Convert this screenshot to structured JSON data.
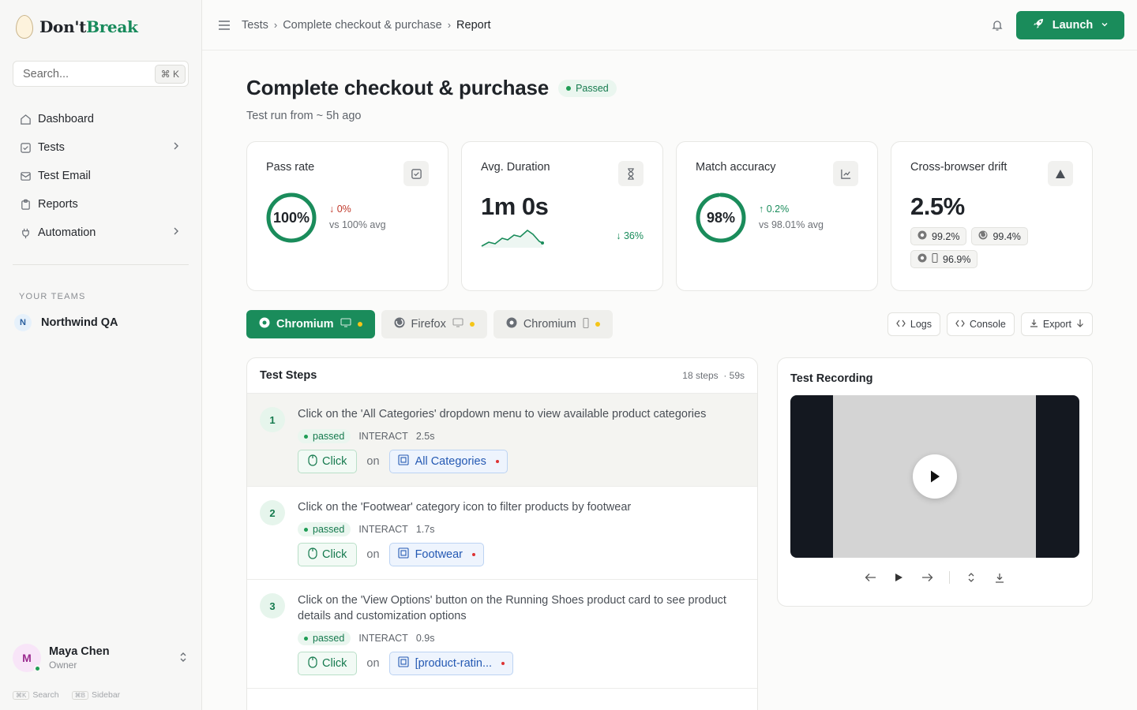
{
  "brand": {
    "name_prefix": "Don't",
    "name_accent": "Break"
  },
  "sidebar": {
    "search_placeholder": "Search...",
    "search_shortcut": "⌘ K",
    "items": [
      {
        "label": "Dashboard",
        "icon": "home-icon"
      },
      {
        "label": "Tests",
        "icon": "checkbox-icon",
        "has_children": true
      },
      {
        "label": "Test Email",
        "icon": "mail-icon"
      },
      {
        "label": "Reports",
        "icon": "clipboard-icon"
      },
      {
        "label": "Automation",
        "icon": "plug-icon",
        "has_children": true
      }
    ],
    "teams_heading": "YOUR TEAMS",
    "team": {
      "initial": "N",
      "name": "Northwind QA"
    },
    "user": {
      "initial": "M",
      "name": "Maya Chen",
      "role": "Owner"
    },
    "shortcuts": [
      {
        "key": "⌘K",
        "label": "Search"
      },
      {
        "key": "⌘B",
        "label": "Sidebar"
      }
    ]
  },
  "header": {
    "breadcrumbs": [
      "Tests",
      "Complete checkout & purchase",
      "Report"
    ],
    "launch_label": "Launch"
  },
  "page": {
    "title": "Complete checkout & purchase",
    "status": "Passed",
    "subtitle": "Test run from ~ 5h ago"
  },
  "stats": {
    "pass_rate": {
      "label": "Pass rate",
      "value": "100%",
      "percent": 100,
      "delta": "↓ 0%",
      "vs": "vs 100% avg"
    },
    "duration": {
      "label": "Avg. Duration",
      "value": "1m 0s",
      "delta": "↓ 36%"
    },
    "match": {
      "label": "Match accuracy",
      "value": "98%",
      "percent": 98,
      "delta": "↑ 0.2%",
      "vs": "vs 98.01% avg"
    },
    "drift": {
      "label": "Cross-browser drift",
      "value": "2.5%",
      "chips": [
        {
          "browser": "chromium",
          "device": "",
          "value": "99.2%"
        },
        {
          "browser": "firefox",
          "device": "",
          "value": "99.4%"
        },
        {
          "browser": "chromium",
          "device": "mobile",
          "value": "96.9%"
        }
      ]
    }
  },
  "browser_tabs": [
    {
      "label": "Chromium",
      "device": "desktop",
      "active": true
    },
    {
      "label": "Firefox",
      "device": "desktop",
      "active": false
    },
    {
      "label": "Chromium",
      "device": "mobile",
      "active": false
    }
  ],
  "tools": {
    "logs": "Logs",
    "console": "Console",
    "export": "Export"
  },
  "steps": {
    "title": "Test Steps",
    "count": "18 steps",
    "duration": "· 59s",
    "on_label": "on",
    "items": [
      {
        "num": "1",
        "text": "Click on the 'All Categories' dropdown menu to view available product categories",
        "status": "passed",
        "type": "INTERACT",
        "time": "2.5s",
        "action": "Click",
        "target": "All Categories"
      },
      {
        "num": "2",
        "text": "Click on the 'Footwear' category icon to filter products by footwear",
        "status": "passed",
        "type": "INTERACT",
        "time": "1.7s",
        "action": "Click",
        "target": "Footwear"
      },
      {
        "num": "3",
        "text": "Click on the 'View Options' button on the Running Shoes product card to see product details and customization options",
        "status": "passed",
        "type": "INTERACT",
        "time": "0.9s",
        "action": "Click",
        "target": "[product-ratin..."
      }
    ]
  },
  "recording": {
    "title": "Test Recording"
  },
  "colors": {
    "accent": "#1a8c5b",
    "warning_dot": "#f5c518",
    "danger": "#c0392b"
  }
}
